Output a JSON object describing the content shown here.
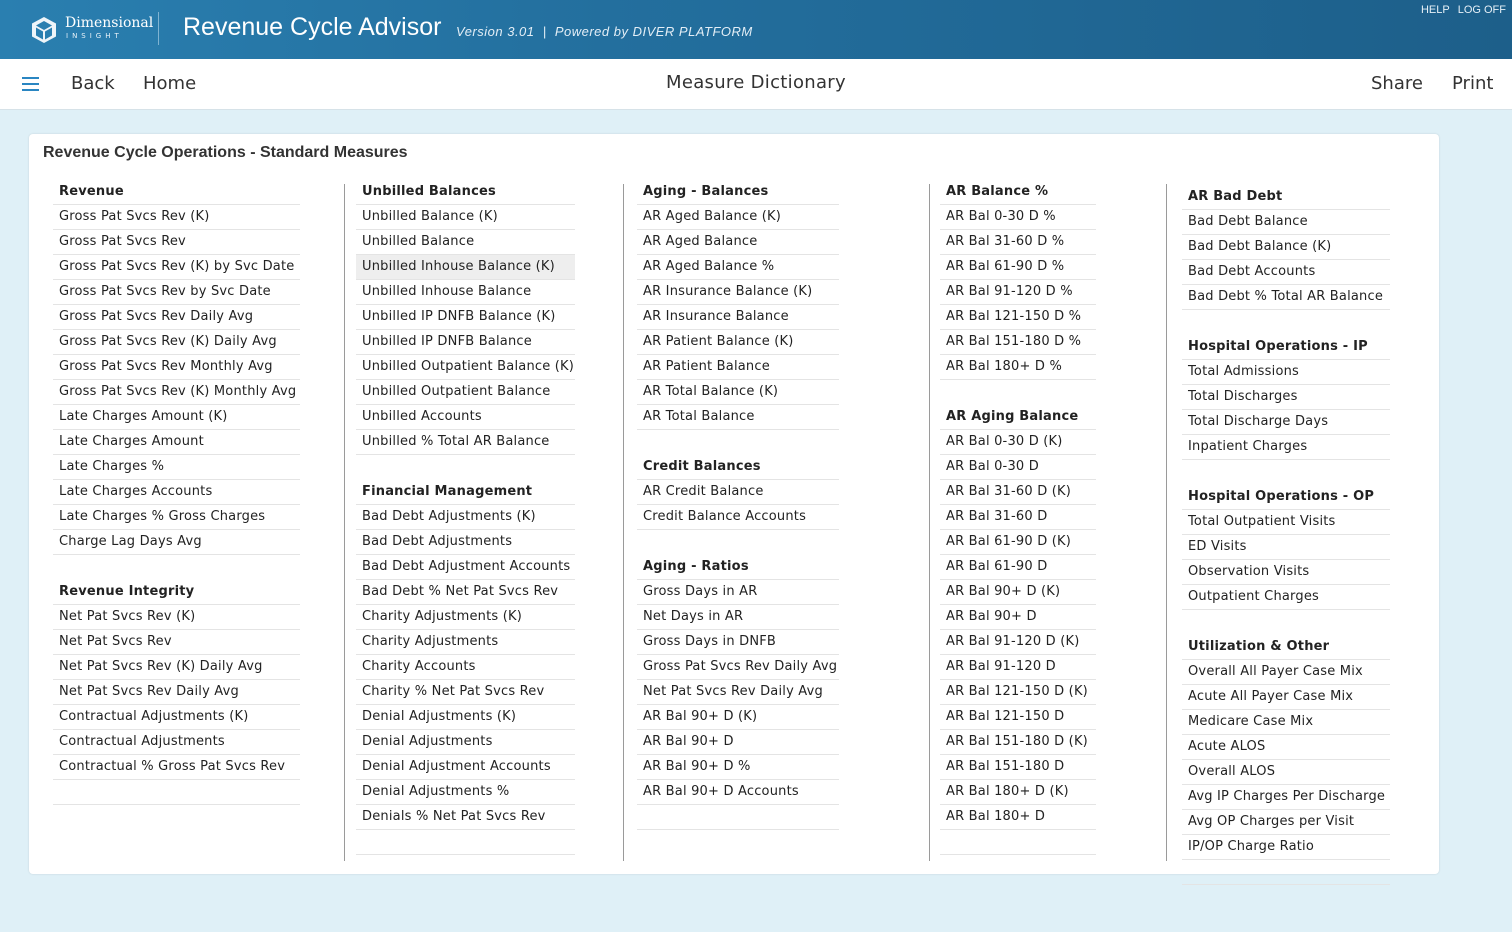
{
  "header": {
    "brand_line1": "Dimensional",
    "brand_line2": "INSIGHT",
    "app_title": "Revenue Cycle Advisor",
    "version": "Version 3.01  |  Powered by DIVER PLATFORM",
    "help": "HELP",
    "logoff": "LOG OFF"
  },
  "nav": {
    "back": "Back",
    "home": "Home",
    "title": "Measure Dictionary",
    "share": "Share",
    "print": "Print"
  },
  "card": {
    "title": "Revenue Cycle Operations - Standard Measures",
    "columns": [
      {
        "sections": [
          {
            "title": "Revenue",
            "items": [
              "Gross Pat Svcs Rev (K)",
              "Gross Pat Svcs Rev",
              "Gross Pat Svcs Rev (K) by Svc Date",
              "Gross Pat Svcs Rev by Svc Date",
              "Gross Pat Svcs Rev Daily Avg",
              "Gross Pat Svcs Rev (K) Daily Avg",
              "Gross Pat Svcs Rev Monthly Avg",
              "Gross Pat Svcs Rev (K) Monthly Avg",
              "Late Charges Amount (K)",
              "Late Charges Amount",
              "Late Charges %",
              "Late Charges Accounts",
              "Late Charges % Gross Charges",
              "Charge Lag Days Avg"
            ]
          },
          {
            "title": "Revenue Integrity",
            "items": [
              "Net Pat Svcs Rev (K)",
              "Net Pat Svcs Rev",
              "Net Pat Svcs Rev (K) Daily Avg",
              "Net Pat Svcs Rev Daily Avg",
              "Contractual Adjustments (K)",
              "Contractual Adjustments",
              "Contractual % Gross Pat Svcs Rev"
            ]
          }
        ]
      },
      {
        "sections": [
          {
            "title": "Unbilled Balances",
            "items": [
              "Unbilled Balance (K)",
              "Unbilled Balance",
              "Unbilled Inhouse Balance (K)",
              "Unbilled Inhouse Balance",
              "Unbilled IP DNFB Balance (K)",
              "Unbilled IP DNFB Balance",
              "Unbilled Outpatient Balance (K)",
              "Unbilled Outpatient Balance",
              "Unbilled Accounts",
              "Unbilled % Total AR Balance"
            ]
          },
          {
            "title": "Financial Management",
            "items": [
              "Bad Debt Adjustments (K)",
              "Bad Debt Adjustments",
              "Bad Debt Adjustment Accounts",
              "Bad Debt % Net Pat Svcs Rev",
              "Charity Adjustments (K)",
              "Charity Adjustments",
              "Charity Accounts",
              "Charity % Net Pat Svcs Rev",
              "Denial Adjustments (K)",
              "Denial Adjustments",
              "Denial Adjustment Accounts",
              "Denial Adjustments %",
              "Denials % Net Pat Svcs Rev"
            ]
          }
        ]
      },
      {
        "sections": [
          {
            "title": "Aging - Balances",
            "items": [
              "AR Aged Balance (K)",
              "AR Aged Balance",
              "AR Aged Balance %",
              "AR Insurance Balance (K)",
              "AR Insurance Balance",
              "AR Patient Balance (K)",
              "AR Patient Balance",
              "AR Total Balance (K)",
              "AR Total Balance"
            ]
          },
          {
            "title": "Credit Balances",
            "items": [
              "AR Credit Balance",
              "Credit Balance Accounts"
            ]
          },
          {
            "title": "Aging - Ratios",
            "items": [
              "Gross Days in AR",
              "Net Days in AR",
              "Gross Days in DNFB",
              "Gross Pat Svcs Rev Daily Avg",
              "Net Pat Svcs Rev Daily Avg",
              "AR Bal 90+ D (K)",
              "AR Bal 90+ D",
              "AR Bal 90+ D %",
              "AR Bal 90+ D Accounts"
            ]
          }
        ]
      },
      {
        "sections": [
          {
            "title": "AR Balance %",
            "items": [
              "AR Bal 0-30 D %",
              "AR Bal 31-60 D %",
              "AR Bal 61-90 D %",
              "AR Bal 91-120 D %",
              "AR Bal 121-150 D %",
              "AR Bal 151-180 D %",
              "AR Bal 180+ D %"
            ]
          },
          {
            "title": "AR Aging Balance",
            "items": [
              "AR Bal 0-30 D (K)",
              "AR Bal 0-30 D",
              "AR Bal 31-60 D (K)",
              "AR Bal 31-60 D",
              "AR Bal 61-90 D (K)",
              "AR Bal 61-90 D",
              "AR Bal 90+ D (K)",
              "AR Bal 90+ D",
              "AR Bal 91-120 D (K)",
              "AR Bal 91-120 D",
              "AR Bal 121-150 D (K)",
              "AR Bal 121-150 D",
              "AR Bal 151-180 D (K)",
              "AR Bal 151-180 D",
              "AR Bal 180+ D (K)",
              "AR Bal 180+ D"
            ]
          }
        ]
      },
      {
        "sections": [
          {
            "title": "AR Bad Debt",
            "items": [
              "Bad Debt Balance",
              "Bad Debt Balance (K)",
              "Bad Debt Accounts",
              "Bad Debt % Total AR Balance"
            ]
          },
          {
            "title": "Hospital Operations - IP",
            "items": [
              "Total Admissions",
              "Total Discharges",
              "Total Discharge Days",
              "Inpatient Charges"
            ]
          },
          {
            "title": "Hospital Operations - OP",
            "items": [
              "Total Outpatient Visits",
              "ED Visits",
              "Observation Visits",
              "Outpatient Charges"
            ]
          },
          {
            "title": "Utilization & Other",
            "items": [
              "Overall All Payer Case Mix",
              "Acute All Payer Case Mix",
              "Medicare Case Mix",
              "Acute ALOS",
              "Overall ALOS",
              "Avg IP Charges Per Discharge",
              "Avg OP Charges per Visit",
              "IP/OP Charge Ratio"
            ]
          }
        ]
      }
    ]
  }
}
